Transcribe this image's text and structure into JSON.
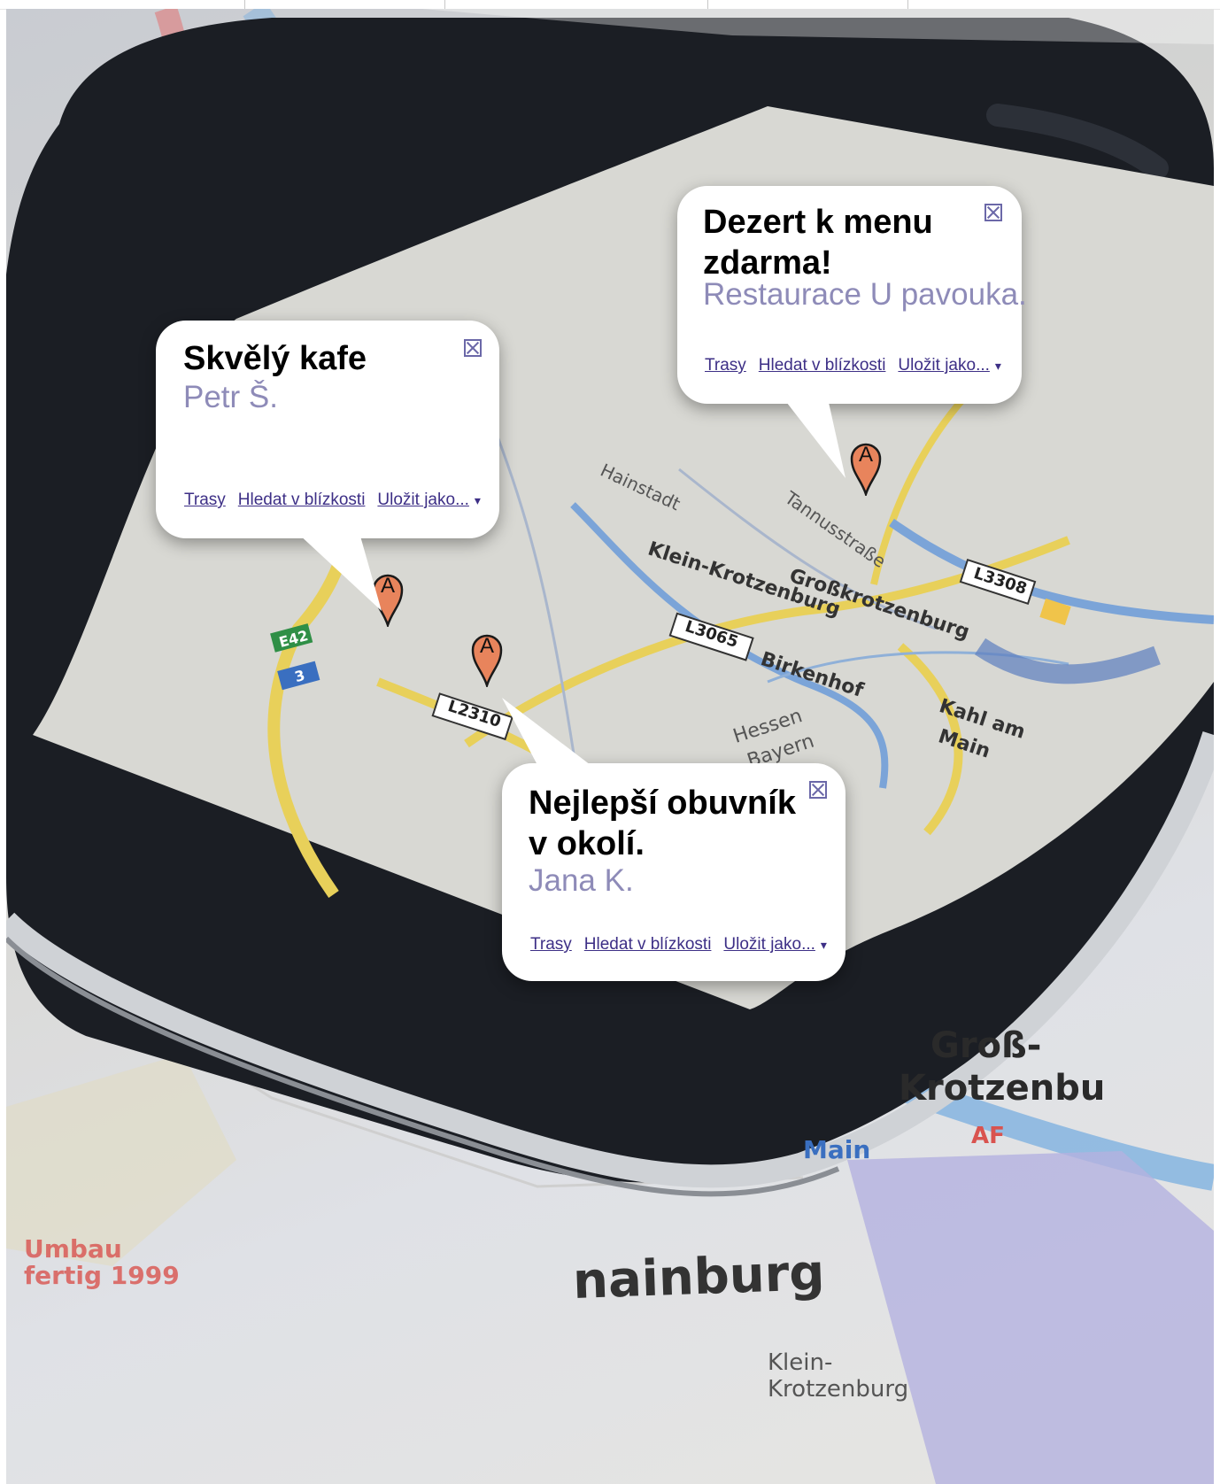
{
  "background": {
    "map_labels": [
      "Groß-",
      "Krotzenbu",
      "nainburg",
      "Main",
      "AF",
      "Umbau",
      "fertig 1999",
      "Klein-",
      "Krotzenburg",
      "Großkrotzenburg",
      "Klein-Krotzenburg",
      "Birkenhof",
      "Hessen",
      "Bayern",
      "Kahl am",
      "Main",
      "L3065",
      "L2310",
      "L3308",
      "E42",
      "3",
      "Hainstadt",
      "Tannusstraße"
    ]
  },
  "bubbles": [
    {
      "title": "Skvělý kafe",
      "author": "Petr Š.",
      "links": [
        "Trasy",
        "Hledat v blízkosti",
        "Uložit jako..."
      ],
      "caret": "▾"
    },
    {
      "title": "Dezert k menu zdarma!",
      "author": "Restaurace U pavouka.",
      "links": [
        "Trasy",
        "Hledat v blízkosti",
        "Uložit jako..."
      ],
      "caret": "▾"
    },
    {
      "title": "Nejlepší obuvník v okolí.",
      "author": "Jana K.",
      "links": [
        "Trasy",
        "Hledat v blízkosti",
        "Uložit jako..."
      ],
      "caret": "▾"
    }
  ],
  "pins": [
    {
      "label": "A",
      "color": "#e8845c"
    },
    {
      "label": "A",
      "color": "#e8845c"
    },
    {
      "label": "A",
      "color": "#e8845c"
    }
  ],
  "colors": {
    "link": "#3d2f86",
    "author": "#8e8bb8",
    "pin": "#e8845c"
  }
}
